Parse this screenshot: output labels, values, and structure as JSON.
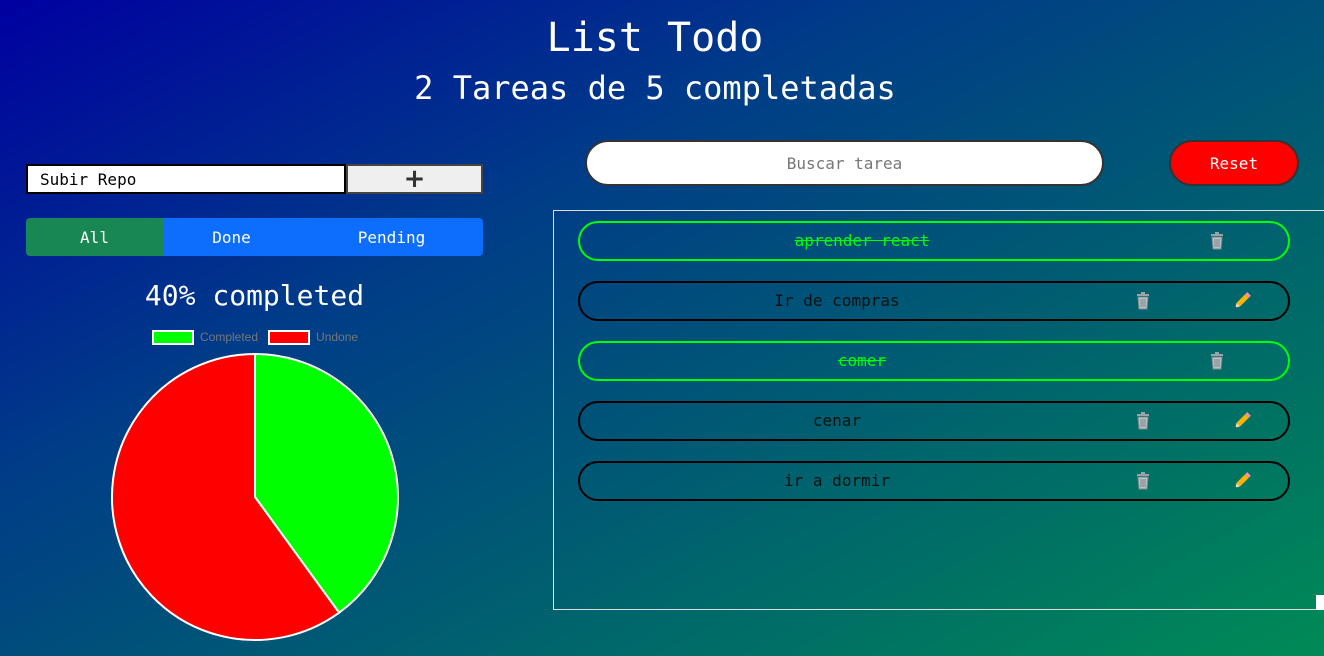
{
  "header": {
    "title": "List Todo",
    "subtitle": "2 Tareas de 5 completadas"
  },
  "new_task": {
    "value": "Subir Repo",
    "add_label": "+"
  },
  "filters": {
    "all": "All",
    "done": "Done",
    "pending": "Pending",
    "active": "all"
  },
  "progress": {
    "label": "40% completed",
    "fraction": 0.4
  },
  "chart_data": {
    "type": "pie",
    "labels": [
      "Completed",
      "Undone"
    ],
    "values": [
      40,
      60
    ],
    "colors": [
      "#00ff00",
      "#ff0000"
    ],
    "legend": "top"
  },
  "search": {
    "placeholder": "Buscar tarea",
    "value": ""
  },
  "reset_label": "Reset",
  "todos": [
    {
      "text": "aprender react",
      "done": true
    },
    {
      "text": "Ir de compras",
      "done": false
    },
    {
      "text": "comer",
      "done": true
    },
    {
      "text": "cenar",
      "done": false
    },
    {
      "text": "ir a dormir",
      "done": false
    }
  ],
  "colors": {
    "done": "#00ff00",
    "filter_active": "#198754",
    "filter_inactive": "#0d6efd",
    "reset": "#ff0000"
  }
}
